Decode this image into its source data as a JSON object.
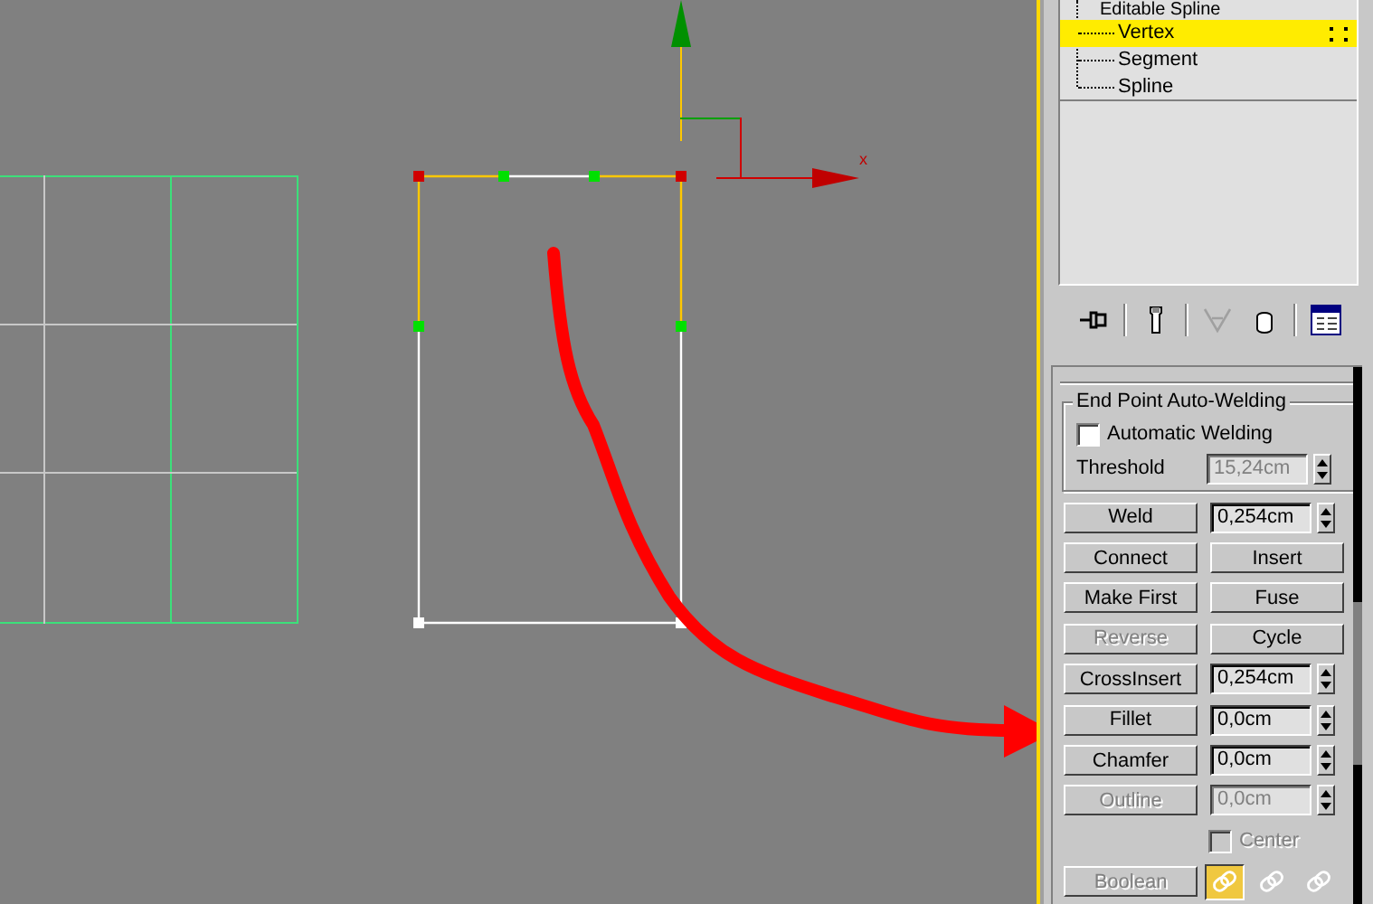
{
  "viewport": {
    "axis_label": "x"
  },
  "modifier_stack": {
    "title": "Editable Spline",
    "items": [
      {
        "label": "Vertex",
        "selected": true
      },
      {
        "label": "Segment",
        "selected": false
      },
      {
        "label": "Spline",
        "selected": false
      }
    ]
  },
  "rollout": {
    "group": {
      "title": "End Point Auto-Welding",
      "checkbox": {
        "label": "Automatic Welding",
        "checked": false
      },
      "threshold": {
        "label": "Threshold",
        "value": "15,24cm",
        "disabled": true
      }
    },
    "rows": [
      {
        "kind": "spinner",
        "left": {
          "label": "Weld",
          "disabled": false
        },
        "field": {
          "value": "0,254cm",
          "disabled": false
        }
      },
      {
        "kind": "pair",
        "left": {
          "label": "Connect",
          "disabled": false
        },
        "right": {
          "label": "Insert",
          "disabled": false
        }
      },
      {
        "kind": "pair",
        "left": {
          "label": "Make First",
          "disabled": false
        },
        "right": {
          "label": "Fuse",
          "disabled": false
        }
      },
      {
        "kind": "pair",
        "left": {
          "label": "Reverse",
          "disabled": true
        },
        "right": {
          "label": "Cycle",
          "disabled": false
        }
      },
      {
        "kind": "spinner",
        "left": {
          "label": "CrossInsert",
          "disabled": false
        },
        "field": {
          "value": "0,254cm",
          "disabled": false
        }
      },
      {
        "kind": "spinner",
        "left": {
          "label": "Fillet",
          "disabled": false
        },
        "field": {
          "value": "0,0cm",
          "disabled": false
        }
      },
      {
        "kind": "spinner",
        "left": {
          "label": "Chamfer",
          "disabled": false
        },
        "field": {
          "value": "0,0cm",
          "disabled": false
        }
      },
      {
        "kind": "spinner",
        "left": {
          "label": "Outline",
          "disabled": true
        },
        "field": {
          "value": "0,0cm",
          "disabled": true
        }
      },
      {
        "kind": "checkbox",
        "label": "Center",
        "checked": false,
        "disabled": true
      },
      {
        "kind": "boolean",
        "left": {
          "label": "Boolean",
          "disabled": true
        },
        "modes": [
          {
            "selected": true
          },
          {
            "selected": false
          },
          {
            "selected": false
          }
        ]
      }
    ]
  }
}
